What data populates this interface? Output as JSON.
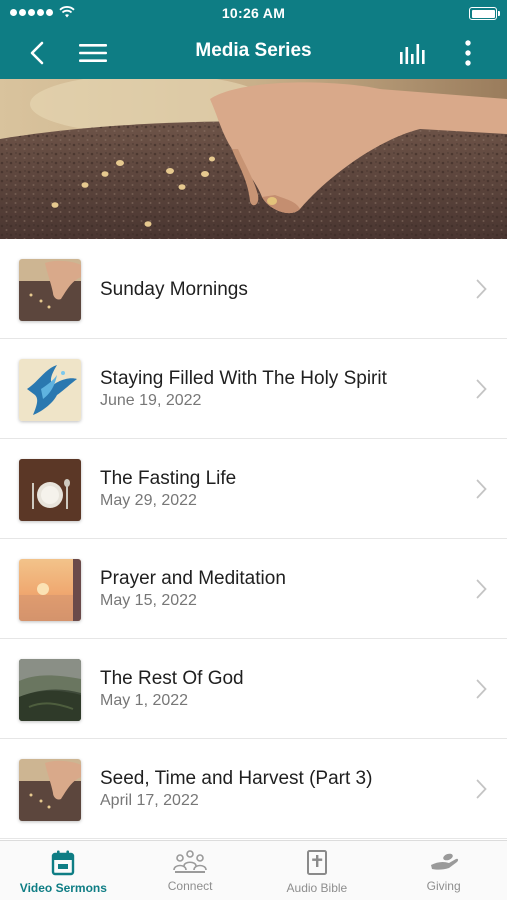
{
  "status_bar": {
    "time": "10:26 AM"
  },
  "header": {
    "title": "Media Series"
  },
  "icons": {
    "back": "chevron-left-icon",
    "menu": "hamburger-menu-icon",
    "audio": "audio-levels-icon",
    "more": "more-vertical-icon"
  },
  "colors": {
    "accent": "#0e7d84",
    "tab_inactive": "#8e8e8e"
  },
  "series": [
    {
      "title": "Sunday Mornings",
      "date": ""
    },
    {
      "title": "Staying Filled With The Holy Spirit",
      "date": "June 19, 2022"
    },
    {
      "title": "The Fasting Life",
      "date": "May 29, 2022"
    },
    {
      "title": "Prayer and Meditation",
      "date": "May 15, 2022"
    },
    {
      "title": "The Rest Of God",
      "date": "May 1, 2022"
    },
    {
      "title": "Seed, Time and Harvest (Part 3)",
      "date": "April 17, 2022"
    }
  ],
  "tabs": [
    {
      "label": "Video Sermons",
      "icon": "calendar-icon",
      "active": true
    },
    {
      "label": "Connect",
      "icon": "people-group-icon",
      "active": false
    },
    {
      "label": "Audio Bible",
      "icon": "bible-icon",
      "active": false
    },
    {
      "label": "Giving",
      "icon": "giving-hand-icon",
      "active": false
    }
  ]
}
